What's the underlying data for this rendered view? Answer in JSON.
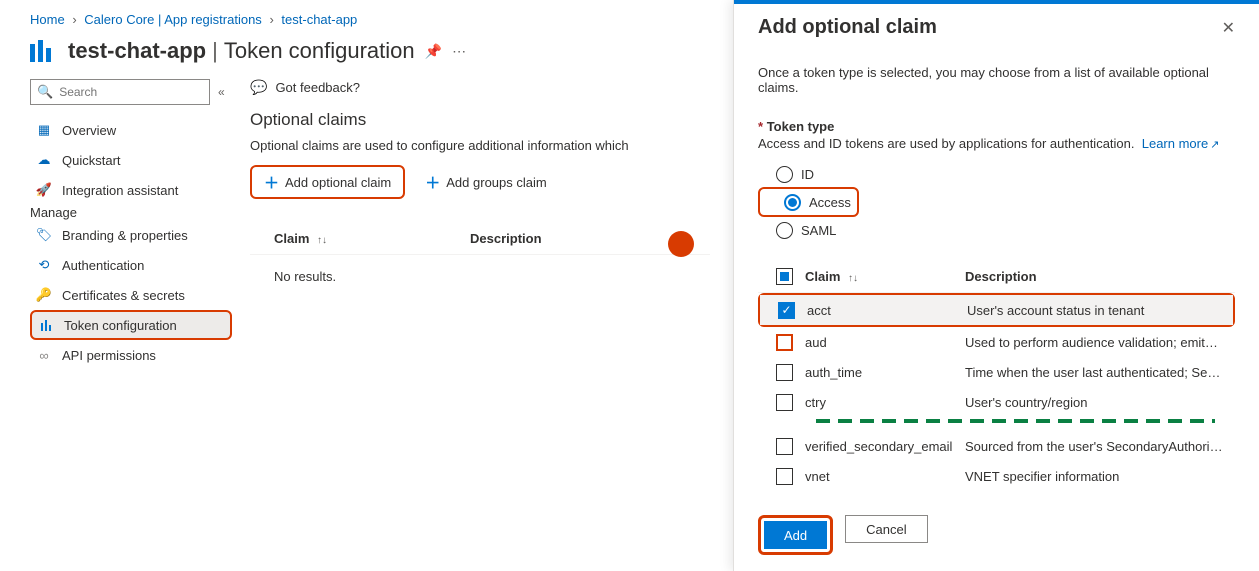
{
  "breadcrumbs": [
    "Home",
    "Calero Core | App registrations",
    "test-chat-app"
  ],
  "page": {
    "app_name": "test-chat-app",
    "subtitle": "Token configuration"
  },
  "sidebar": {
    "search_placeholder": "Search",
    "top_items": [
      {
        "icon": "overview-icon",
        "label": "Overview"
      },
      {
        "icon": "quickstart-icon",
        "label": "Quickstart"
      },
      {
        "icon": "integration-icon",
        "label": "Integration assistant"
      }
    ],
    "manage_label": "Manage",
    "manage_items": [
      {
        "icon": "branding-icon",
        "label": "Branding & properties"
      },
      {
        "icon": "auth-icon",
        "label": "Authentication"
      },
      {
        "icon": "certs-icon",
        "label": "Certificates & secrets"
      },
      {
        "icon": "token-config-icon",
        "label": "Token configuration",
        "selected": true
      },
      {
        "icon": "api-perm-icon",
        "label": "API permissions"
      }
    ]
  },
  "content": {
    "feedback": "Got feedback?",
    "section_title": "Optional claims",
    "section_sub": "Optional claims are used to configure additional information which",
    "add_optional": "Add optional claim",
    "add_groups": "Add groups claim",
    "col_claim": "Claim",
    "col_desc": "Description",
    "no_results": "No results."
  },
  "panel": {
    "title": "Add optional claim",
    "desc": "Once a token type is selected, you may choose from a list of available optional claims.",
    "token_type_label": "Token type",
    "token_type_desc": "Access and ID tokens are used by applications for authentication.",
    "learn_more": "Learn more",
    "radios": [
      {
        "label": "ID",
        "selected": false
      },
      {
        "label": "Access",
        "selected": true
      },
      {
        "label": "SAML",
        "selected": false
      }
    ],
    "col_claim": "Claim",
    "col_desc": "Description",
    "rows1": [
      {
        "claim": "acct",
        "desc": "User's account status in tenant",
        "checked": true,
        "hl": true
      },
      {
        "claim": "aud",
        "desc": "Used to perform audience validation; emits the client ID…",
        "checked": false,
        "redbox": true
      },
      {
        "claim": "auth_time",
        "desc": "Time when the user last authenticated; See OpenID Con…",
        "checked": false
      },
      {
        "claim": "ctry",
        "desc": "User's country/region",
        "checked": false
      }
    ],
    "rows2": [
      {
        "claim": "verified_secondary_email",
        "desc": "Sourced from the user's SecondaryAuthoritativeEmail",
        "checked": false
      },
      {
        "claim": "vnet",
        "desc": "VNET specifier information",
        "checked": false
      }
    ],
    "add_button": "Add",
    "cancel_button": "Cancel"
  }
}
